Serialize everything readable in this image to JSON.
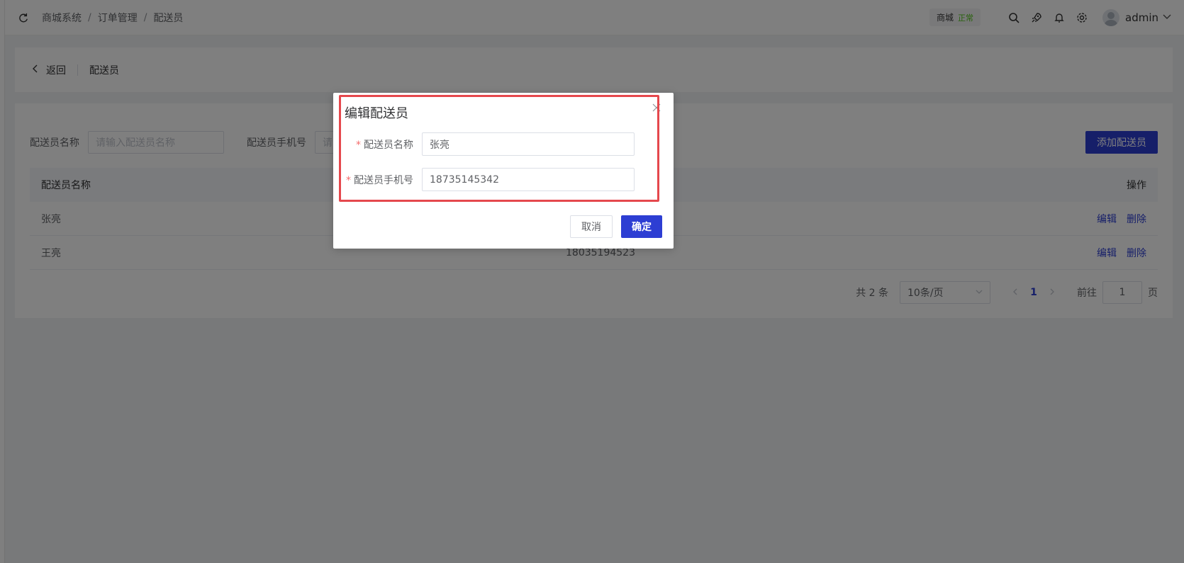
{
  "header": {
    "breadcrumb": [
      "商城系统",
      "订单管理",
      "配送员"
    ],
    "separator": "/",
    "store_name": "商城",
    "store_status": "正常",
    "username": "admin"
  },
  "page_head": {
    "back_label": "返回",
    "title": "配送员"
  },
  "search": {
    "name_label": "配送员名称",
    "name_placeholder": "请输入配送员名称",
    "phone_label": "配送员手机号",
    "phone_placeholder": "请",
    "add_button": "添加配送员"
  },
  "table": {
    "columns": [
      "配送员名称",
      "",
      "操作"
    ],
    "rows": [
      {
        "name": "张亮",
        "phone": "",
        "edit": "编辑",
        "delete": "删除"
      },
      {
        "name": "王亮",
        "phone": "18035194523",
        "edit": "编辑",
        "delete": "删除"
      }
    ]
  },
  "pagination": {
    "total": "共 2 条",
    "page_size": "10条/页",
    "current_page": "1",
    "goto_label": "前往",
    "goto_value": "1",
    "page_suffix": "页"
  },
  "dialog": {
    "title": "编辑配送员",
    "name_label": "配送员名称",
    "name_value": "张亮",
    "phone_label": "配送员手机号",
    "phone_value": "18735145342",
    "required_mark": "*",
    "cancel_button": "取消",
    "confirm_button": "确定"
  },
  "colors": {
    "primary": "#2d3ed3",
    "highlight_border": "#e5484d",
    "status_green": "#52c41a"
  }
}
